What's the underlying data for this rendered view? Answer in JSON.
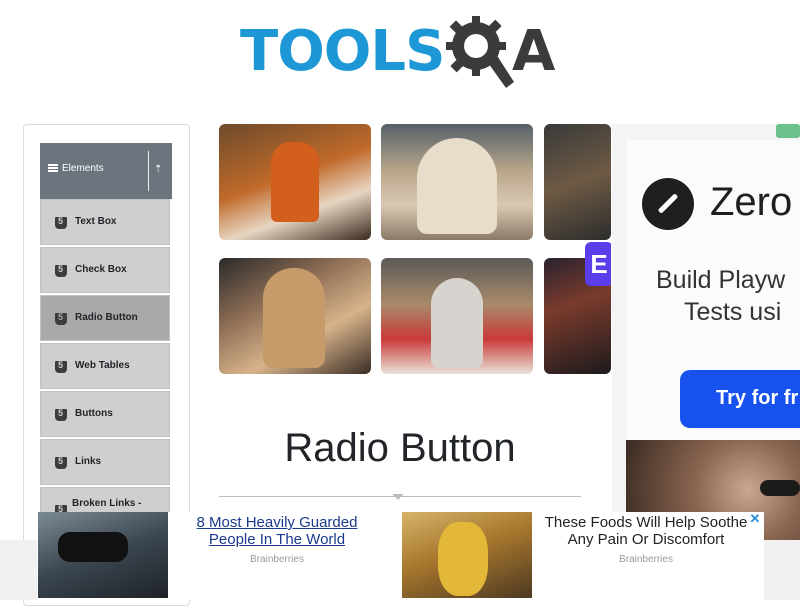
{
  "logo": {
    "text": "TOOLS",
    "letter_a": "A",
    "brand_color": "#1d97d5"
  },
  "sidebar": {
    "group_title": "Elements",
    "items": [
      {
        "label": "Text Box",
        "active": false
      },
      {
        "label": "Check Box",
        "active": false
      },
      {
        "label": "Radio Button",
        "active": true
      },
      {
        "label": "Web Tables",
        "active": false
      },
      {
        "label": "Buttons",
        "active": false
      },
      {
        "label": "Links",
        "active": false
      },
      {
        "label": "Broken Links -",
        "active": false
      }
    ]
  },
  "main": {
    "title": "Radio Button",
    "banner_badge": "E"
  },
  "side_ad": {
    "brand": "Zero",
    "headline_line1": "Build Playw",
    "headline_line2": "Tests usi",
    "cta": "Try for fr"
  },
  "bottom_ad": {
    "left": {
      "headline": "8 Most Heavily Guarded People In The World",
      "source": "Brainberries"
    },
    "right": {
      "headline": "These Foods Will Help Soothe Any Pain Or Discomfort",
      "source": "Brainberries"
    },
    "close": "✕"
  },
  "colors": {
    "accent": "#1d97d5",
    "sidebar_header": "#6c757d",
    "active_item": "#a9a9a9",
    "cta": "#1852ee"
  }
}
